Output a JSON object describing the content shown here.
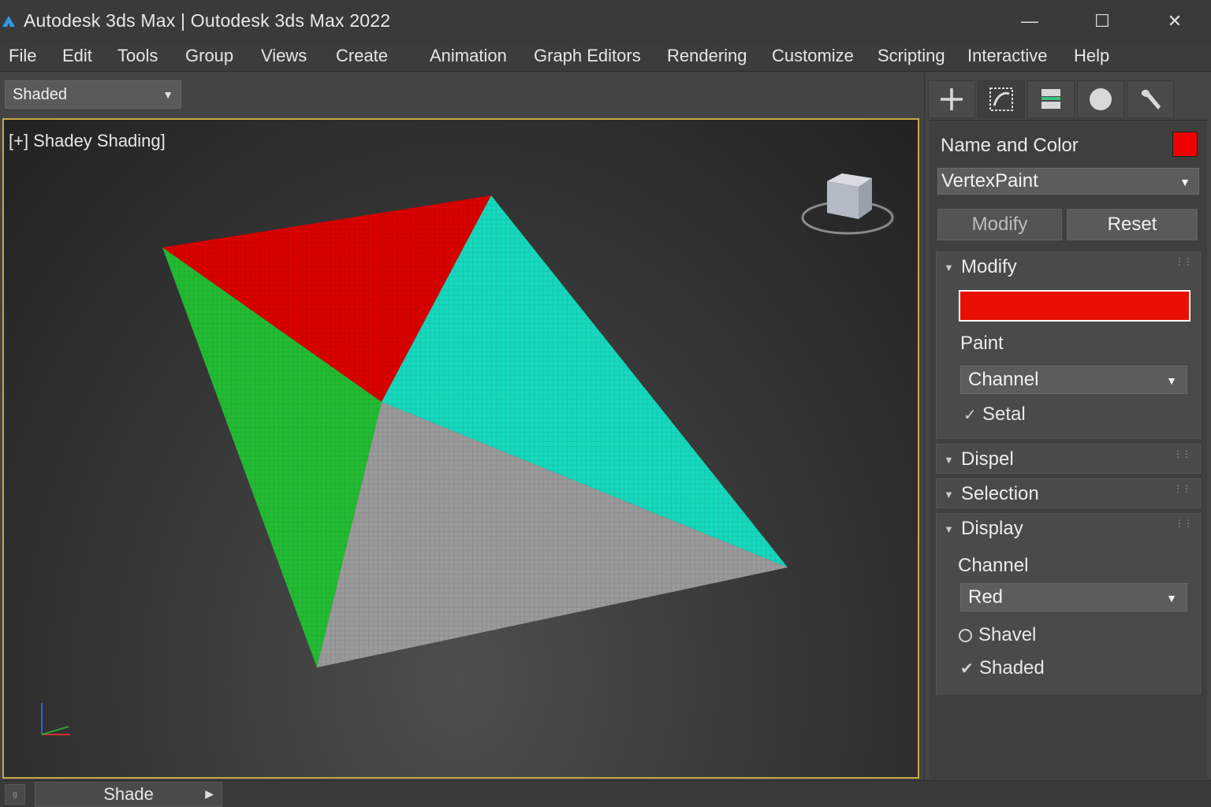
{
  "window": {
    "title": "Autodesk 3ds Max | Outodesk 3ds Max 2022",
    "minimize": "—",
    "maximize": "☐",
    "close": "✕"
  },
  "menu": [
    "File",
    "Edit",
    "Tools",
    "Group",
    "Views",
    "Create",
    "Animation",
    "Graph Editors",
    "Rendering",
    "Customize",
    "Scripting",
    "Interactive",
    "Help"
  ],
  "toolbar": {
    "shading_mode": "Shaded"
  },
  "viewport": {
    "label": "[+] Shadey Shading]",
    "colors": {
      "red": "#d80000",
      "cyan": "#16d8bd",
      "green": "#22bb33",
      "gray": "#9a9a9a"
    }
  },
  "bottom": {
    "tab_label": "Shade",
    "small_button": "g"
  },
  "command_panel": {
    "tabs": [
      "create-icon",
      "modify-icon",
      "hierarchy-icon",
      "motion-icon",
      "utilities-icon"
    ],
    "name_and_color_label": "Name and Color",
    "object_color": "#ee0000",
    "modifier": "VertexPaint",
    "modify_button": "Modify",
    "reset_button": "Reset",
    "rollouts": {
      "modify": {
        "title": "Modify",
        "paint_color": "#e81000",
        "paint_label": "Paint",
        "channel_value": "Channel",
        "setal_label": "Setal"
      },
      "dispel": {
        "title": "Dispel"
      },
      "selection": {
        "title": "Selection"
      },
      "display": {
        "title": "Display",
        "channel_label": "Channel",
        "channel_value": "Red",
        "shavel_label": "Shavel",
        "shaded_label": "Shaded"
      }
    }
  }
}
